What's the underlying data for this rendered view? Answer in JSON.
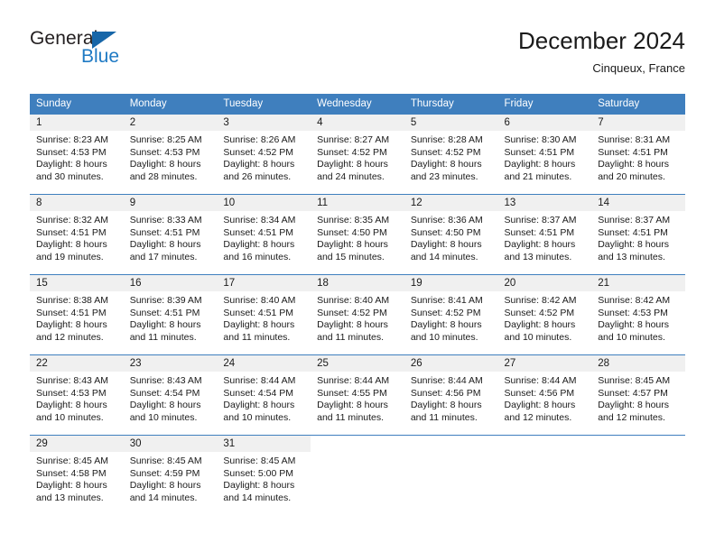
{
  "brand": {
    "name_primary": "General",
    "name_secondary": "Blue",
    "accent_color": "#1766a8",
    "text_color": "#1f7ac4",
    "logo_icon": "triangle-icon"
  },
  "header": {
    "title": "December 2024",
    "subtitle": "Cinqueux, France"
  },
  "theme": {
    "header_row_bg": "#3f7fbe",
    "daynum_bg": "#f0f0f0",
    "grid_line": "#3f7fbe",
    "text": "#1a1a1a"
  },
  "weekday_headers": [
    "Sunday",
    "Monday",
    "Tuesday",
    "Wednesday",
    "Thursday",
    "Friday",
    "Saturday"
  ],
  "weeks": [
    [
      {
        "day": "1",
        "sunrise": "Sunrise: 8:23 AM",
        "sunset": "Sunset: 4:53 PM",
        "daylight_line1": "Daylight: 8 hours",
        "daylight_line2": "and 30 minutes."
      },
      {
        "day": "2",
        "sunrise": "Sunrise: 8:25 AM",
        "sunset": "Sunset: 4:53 PM",
        "daylight_line1": "Daylight: 8 hours",
        "daylight_line2": "and 28 minutes."
      },
      {
        "day": "3",
        "sunrise": "Sunrise: 8:26 AM",
        "sunset": "Sunset: 4:52 PM",
        "daylight_line1": "Daylight: 8 hours",
        "daylight_line2": "and 26 minutes."
      },
      {
        "day": "4",
        "sunrise": "Sunrise: 8:27 AM",
        "sunset": "Sunset: 4:52 PM",
        "daylight_line1": "Daylight: 8 hours",
        "daylight_line2": "and 24 minutes."
      },
      {
        "day": "5",
        "sunrise": "Sunrise: 8:28 AM",
        "sunset": "Sunset: 4:52 PM",
        "daylight_line1": "Daylight: 8 hours",
        "daylight_line2": "and 23 minutes."
      },
      {
        "day": "6",
        "sunrise": "Sunrise: 8:30 AM",
        "sunset": "Sunset: 4:51 PM",
        "daylight_line1": "Daylight: 8 hours",
        "daylight_line2": "and 21 minutes."
      },
      {
        "day": "7",
        "sunrise": "Sunrise: 8:31 AM",
        "sunset": "Sunset: 4:51 PM",
        "daylight_line1": "Daylight: 8 hours",
        "daylight_line2": "and 20 minutes."
      }
    ],
    [
      {
        "day": "8",
        "sunrise": "Sunrise: 8:32 AM",
        "sunset": "Sunset: 4:51 PM",
        "daylight_line1": "Daylight: 8 hours",
        "daylight_line2": "and 19 minutes."
      },
      {
        "day": "9",
        "sunrise": "Sunrise: 8:33 AM",
        "sunset": "Sunset: 4:51 PM",
        "daylight_line1": "Daylight: 8 hours",
        "daylight_line2": "and 17 minutes."
      },
      {
        "day": "10",
        "sunrise": "Sunrise: 8:34 AM",
        "sunset": "Sunset: 4:51 PM",
        "daylight_line1": "Daylight: 8 hours",
        "daylight_line2": "and 16 minutes."
      },
      {
        "day": "11",
        "sunrise": "Sunrise: 8:35 AM",
        "sunset": "Sunset: 4:50 PM",
        "daylight_line1": "Daylight: 8 hours",
        "daylight_line2": "and 15 minutes."
      },
      {
        "day": "12",
        "sunrise": "Sunrise: 8:36 AM",
        "sunset": "Sunset: 4:50 PM",
        "daylight_line1": "Daylight: 8 hours",
        "daylight_line2": "and 14 minutes."
      },
      {
        "day": "13",
        "sunrise": "Sunrise: 8:37 AM",
        "sunset": "Sunset: 4:51 PM",
        "daylight_line1": "Daylight: 8 hours",
        "daylight_line2": "and 13 minutes."
      },
      {
        "day": "14",
        "sunrise": "Sunrise: 8:37 AM",
        "sunset": "Sunset: 4:51 PM",
        "daylight_line1": "Daylight: 8 hours",
        "daylight_line2": "and 13 minutes."
      }
    ],
    [
      {
        "day": "15",
        "sunrise": "Sunrise: 8:38 AM",
        "sunset": "Sunset: 4:51 PM",
        "daylight_line1": "Daylight: 8 hours",
        "daylight_line2": "and 12 minutes."
      },
      {
        "day": "16",
        "sunrise": "Sunrise: 8:39 AM",
        "sunset": "Sunset: 4:51 PM",
        "daylight_line1": "Daylight: 8 hours",
        "daylight_line2": "and 11 minutes."
      },
      {
        "day": "17",
        "sunrise": "Sunrise: 8:40 AM",
        "sunset": "Sunset: 4:51 PM",
        "daylight_line1": "Daylight: 8 hours",
        "daylight_line2": "and 11 minutes."
      },
      {
        "day": "18",
        "sunrise": "Sunrise: 8:40 AM",
        "sunset": "Sunset: 4:52 PM",
        "daylight_line1": "Daylight: 8 hours",
        "daylight_line2": "and 11 minutes."
      },
      {
        "day": "19",
        "sunrise": "Sunrise: 8:41 AM",
        "sunset": "Sunset: 4:52 PM",
        "daylight_line1": "Daylight: 8 hours",
        "daylight_line2": "and 10 minutes."
      },
      {
        "day": "20",
        "sunrise": "Sunrise: 8:42 AM",
        "sunset": "Sunset: 4:52 PM",
        "daylight_line1": "Daylight: 8 hours",
        "daylight_line2": "and 10 minutes."
      },
      {
        "day": "21",
        "sunrise": "Sunrise: 8:42 AM",
        "sunset": "Sunset: 4:53 PM",
        "daylight_line1": "Daylight: 8 hours",
        "daylight_line2": "and 10 minutes."
      }
    ],
    [
      {
        "day": "22",
        "sunrise": "Sunrise: 8:43 AM",
        "sunset": "Sunset: 4:53 PM",
        "daylight_line1": "Daylight: 8 hours",
        "daylight_line2": "and 10 minutes."
      },
      {
        "day": "23",
        "sunrise": "Sunrise: 8:43 AM",
        "sunset": "Sunset: 4:54 PM",
        "daylight_line1": "Daylight: 8 hours",
        "daylight_line2": "and 10 minutes."
      },
      {
        "day": "24",
        "sunrise": "Sunrise: 8:44 AM",
        "sunset": "Sunset: 4:54 PM",
        "daylight_line1": "Daylight: 8 hours",
        "daylight_line2": "and 10 minutes."
      },
      {
        "day": "25",
        "sunrise": "Sunrise: 8:44 AM",
        "sunset": "Sunset: 4:55 PM",
        "daylight_line1": "Daylight: 8 hours",
        "daylight_line2": "and 11 minutes."
      },
      {
        "day": "26",
        "sunrise": "Sunrise: 8:44 AM",
        "sunset": "Sunset: 4:56 PM",
        "daylight_line1": "Daylight: 8 hours",
        "daylight_line2": "and 11 minutes."
      },
      {
        "day": "27",
        "sunrise": "Sunrise: 8:44 AM",
        "sunset": "Sunset: 4:56 PM",
        "daylight_line1": "Daylight: 8 hours",
        "daylight_line2": "and 12 minutes."
      },
      {
        "day": "28",
        "sunrise": "Sunrise: 8:45 AM",
        "sunset": "Sunset: 4:57 PM",
        "daylight_line1": "Daylight: 8 hours",
        "daylight_line2": "and 12 minutes."
      }
    ],
    [
      {
        "day": "29",
        "sunrise": "Sunrise: 8:45 AM",
        "sunset": "Sunset: 4:58 PM",
        "daylight_line1": "Daylight: 8 hours",
        "daylight_line2": "and 13 minutes."
      },
      {
        "day": "30",
        "sunrise": "Sunrise: 8:45 AM",
        "sunset": "Sunset: 4:59 PM",
        "daylight_line1": "Daylight: 8 hours",
        "daylight_line2": "and 14 minutes."
      },
      {
        "day": "31",
        "sunrise": "Sunrise: 8:45 AM",
        "sunset": "Sunset: 5:00 PM",
        "daylight_line1": "Daylight: 8 hours",
        "daylight_line2": "and 14 minutes."
      },
      {
        "day": "",
        "sunrise": "",
        "sunset": "",
        "daylight_line1": "",
        "daylight_line2": ""
      },
      {
        "day": "",
        "sunrise": "",
        "sunset": "",
        "daylight_line1": "",
        "daylight_line2": ""
      },
      {
        "day": "",
        "sunrise": "",
        "sunset": "",
        "daylight_line1": "",
        "daylight_line2": ""
      },
      {
        "day": "",
        "sunrise": "",
        "sunset": "",
        "daylight_line1": "",
        "daylight_line2": ""
      }
    ]
  ]
}
